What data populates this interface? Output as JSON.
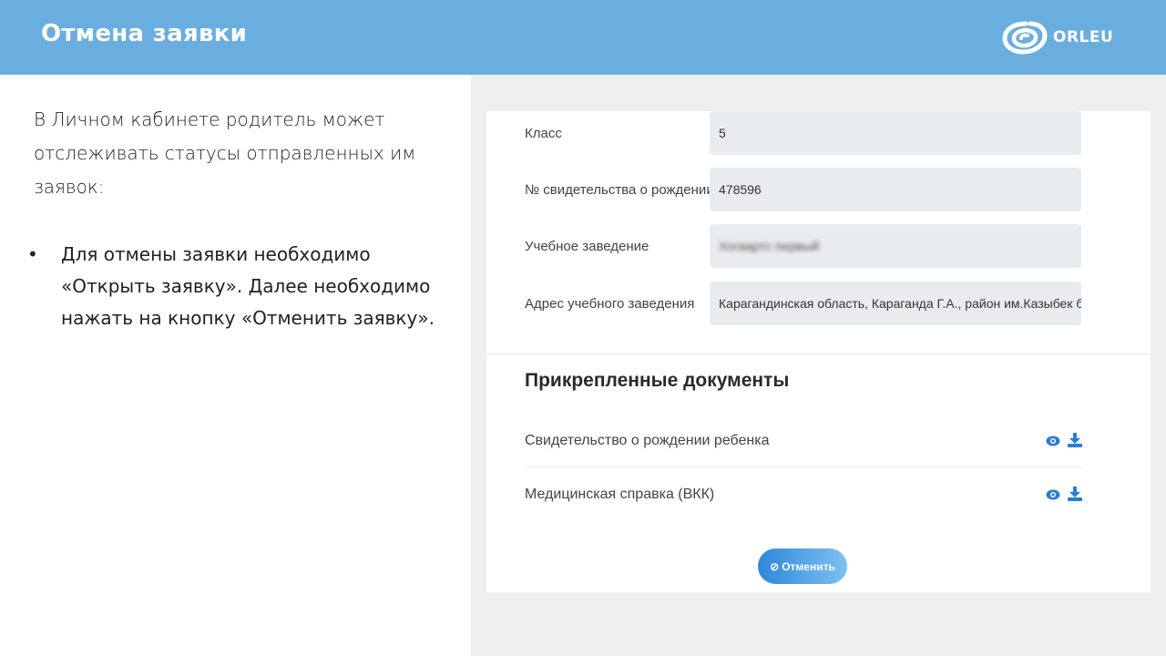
{
  "header": {
    "title": "Отмена заявки",
    "logo_text": "ORLEU",
    "logo_icon": "orleu-logo-icon"
  },
  "intro": {
    "text": "В Личном кабинете родитель может отслеживать статусы отправленных им заявок:"
  },
  "bullets": [
    {
      "marker": "•",
      "text": "Для отмены заявки необходимо «Открыть заявку». Далее необходимо нажать на кнопку «Отменить заявку»."
    }
  ],
  "form": {
    "rows": [
      {
        "label": "Класс",
        "value": "5"
      },
      {
        "label": "№ свидетельства о рождении",
        "value": "478596"
      },
      {
        "label": "Учебное заведение",
        "value": "Хогвартс первый"
      },
      {
        "label": "Адрес учебного заведения",
        "value": "Карагандинская область, Караганда Г.А., район им.Казыбек би, Ерж"
      }
    ]
  },
  "documents": {
    "title": "Прикрепленные документы",
    "items": [
      {
        "label": "Свидетельство о рождении ребенка",
        "view_icon": "eye-icon",
        "download_icon": "download-icon"
      },
      {
        "label": "Медицинская справка (ВКК)",
        "view_icon": "eye-icon",
        "download_icon": "download-icon"
      }
    ]
  },
  "cancel_button": {
    "icon": "⊘",
    "label": "Отменить"
  },
  "colors": {
    "header_bg": "#6aaee0",
    "accent": "#2a7fd4",
    "field_bg": "#e9ecef",
    "panel_bg": "#efefef"
  }
}
